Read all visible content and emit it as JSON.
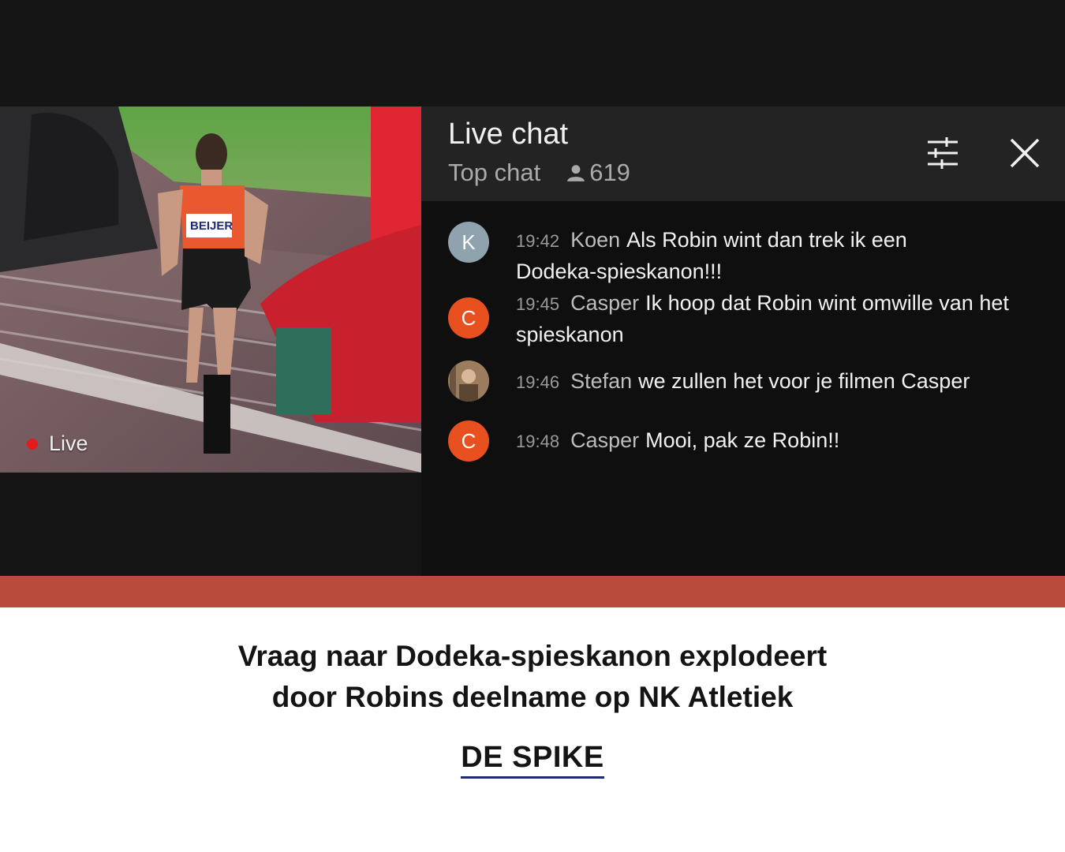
{
  "video": {
    "live_label": "Live",
    "bib_text": "BEIJER"
  },
  "chat": {
    "title": "Live chat",
    "mode": "Top chat",
    "viewer_count": "619",
    "messages": [
      {
        "time": "19:42",
        "author": "Koen",
        "avatar_letter": "K",
        "avatar_color": "#8ea3ad",
        "text": "Als Robin wint dan trek ik een Dodeka-spieskanon!!!"
      },
      {
        "time": "19:45",
        "author": "Casper",
        "avatar_letter": "C",
        "avatar_color": "#e8501f",
        "text": "Ik hoop dat Robin wint omwille van het spieskanon"
      },
      {
        "time": "19:46",
        "author": "Stefan",
        "avatar_letter": "",
        "avatar_color": "#8a6a4a",
        "text": "we zullen het voor je filmen Casper"
      },
      {
        "time": "19:48",
        "author": "Casper",
        "avatar_letter": "C",
        "avatar_color": "#e8501f",
        "text": "Mooi, pak ze Robin!!"
      }
    ]
  },
  "icons": {
    "settings": "sliders-icon",
    "close": "close-icon",
    "viewers": "person-icon"
  },
  "article": {
    "headline_line1": "Vraag naar Dodeka-spieskanon explodeert",
    "headline_line2": "door Robins deelname op NK Atletiek",
    "brand": "DE SPIKE"
  },
  "colors": {
    "accent_band": "#b94b3c",
    "brand_underline": "#1e2a78"
  }
}
